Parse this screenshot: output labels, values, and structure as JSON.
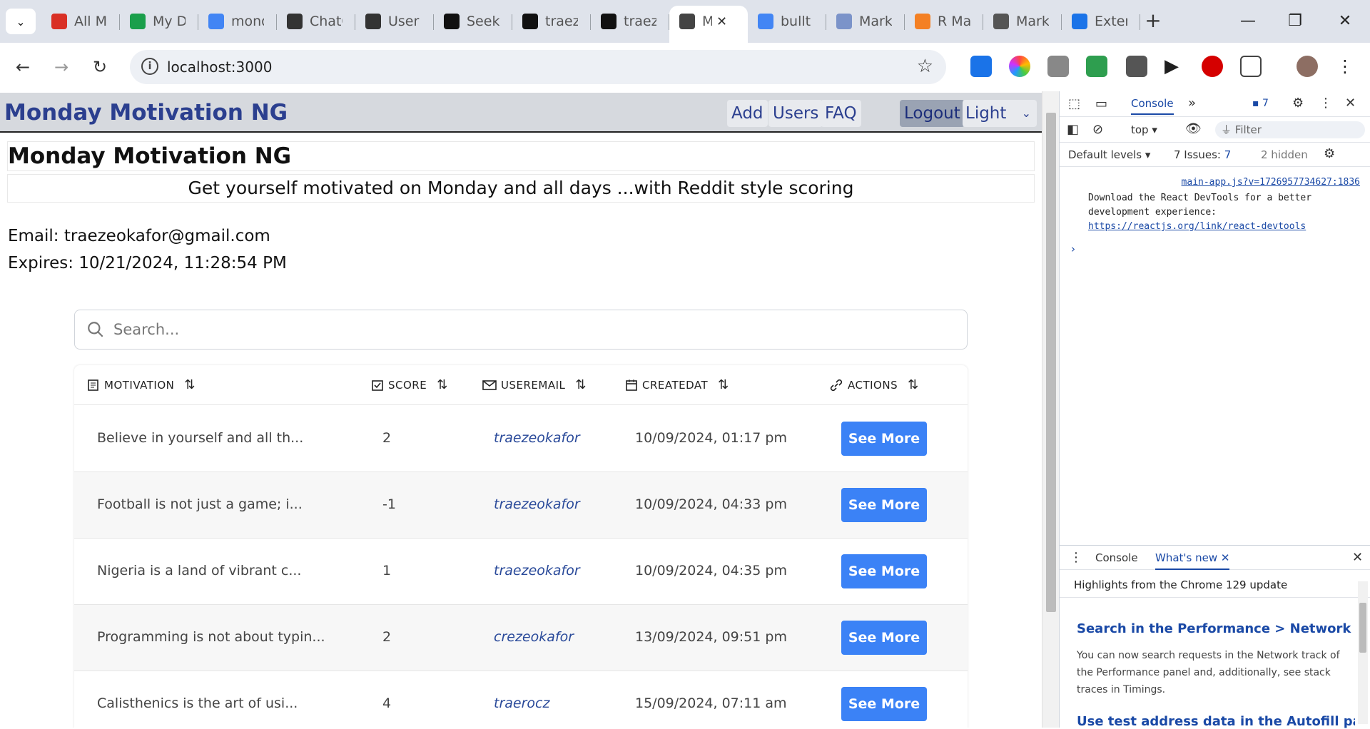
{
  "browser": {
    "tabs": [
      {
        "title": "All Mail",
        "favicon": "gmail-icon",
        "color": "#d93025"
      },
      {
        "title": "My Drive",
        "favicon": "drive-icon",
        "color": "#1a9f4b"
      },
      {
        "title": "monday",
        "favicon": "docs-icon",
        "color": "#4285f4"
      },
      {
        "title": "ChatGPT",
        "favicon": "openai-icon",
        "color": "#333333"
      },
      {
        "title": "User",
        "favicon": "openai-icon",
        "color": "#333333"
      },
      {
        "title": "Seek",
        "favicon": "seek-icon",
        "color": "#111111"
      },
      {
        "title": "traez",
        "favicon": "github-icon",
        "color": "#111111"
      },
      {
        "title": "traez",
        "favicon": "github-icon",
        "color": "#111111"
      },
      {
        "title": "M",
        "favicon": "globe-icon",
        "color": "#444444",
        "active": true
      },
      {
        "title": "bullt",
        "favicon": "google-icon",
        "color": "#4285f4"
      },
      {
        "title": "Mark",
        "favicon": "r-icon",
        "color": "#7b93c9"
      },
      {
        "title": "R Ma",
        "favicon": "stack-icon",
        "color": "#f48024"
      },
      {
        "title": "Mark",
        "favicon": "gear-badge-icon",
        "color": "#555555"
      },
      {
        "title": "Exter",
        "favicon": "puzzle-icon",
        "color": "#1a73e8"
      }
    ],
    "url": "localhost:3000",
    "new_tab": "+",
    "controls": {
      "minimize": "—",
      "restore": "❐",
      "close": "✕"
    }
  },
  "app": {
    "brand": "Monday Motivation NG",
    "nav": {
      "add": "Add",
      "users": "Users",
      "faq": "FAQ",
      "logout": "Logout",
      "theme": "Light"
    },
    "title": "Monday Motivation NG",
    "subtitle": "Get yourself motivated on Monday and all days ...with Reddit style scoring",
    "email_line": "Email: traezeokafor@gmail.com",
    "expires_line": "Expires: 10/21/2024, 11:28:54 PM",
    "search_placeholder": "Search...",
    "table": {
      "headers": {
        "motivation": "MOTIVATION",
        "score": "SCORE",
        "useremail": "USEREMAIL",
        "createdat": "CREATEDAT",
        "actions": "ACTIONS"
      },
      "action_label": "See More",
      "rows": [
        {
          "motivation": "Believe in yourself and all th...",
          "score": "2",
          "useremail": "traezeokafor",
          "createdat": "10/09/2024, 01:17 pm"
        },
        {
          "motivation": "Football is not just a game; i...",
          "score": "-1",
          "useremail": "traezeokafor",
          "createdat": "10/09/2024, 04:33 pm"
        },
        {
          "motivation": "Nigeria is a land of vibrant c...",
          "score": "1",
          "useremail": "traezeokafor",
          "createdat": "10/09/2024, 04:35 pm"
        },
        {
          "motivation": "Programming is not about typin...",
          "score": "2",
          "useremail": "crezeokafor",
          "createdat": "13/09/2024, 09:51 pm"
        },
        {
          "motivation": "Calisthenics is the art of usi...",
          "score": "4",
          "useremail": "traerocz",
          "createdat": "15/09/2024, 07:11 am"
        }
      ]
    }
  },
  "devtools": {
    "tab_console": "Console",
    "issues_badge": "7",
    "context": "top",
    "filter_placeholder": "Filter",
    "levels": "Default levels",
    "issues_label": "7 Issues:",
    "issues_count": "7",
    "hidden": "2 hidden",
    "source_link": "main-app.js?v=1726957734627:1836",
    "message": "Download the React DevTools for a better development experience:",
    "message_link": "https://reactjs.org/link/react-devtools",
    "drawer_tab_console": "Console",
    "drawer_tab_whatsnew": "What's new",
    "highlights": "Highlights from the Chrome 129 update",
    "feature1_title": "Search in the Performance > Network track",
    "feature1_body": "You can now search requests in the Network track of the Performance panel and, additionally, see stack traces in Timings.",
    "feature2_title": "Use test address data in the Autofill panel"
  }
}
